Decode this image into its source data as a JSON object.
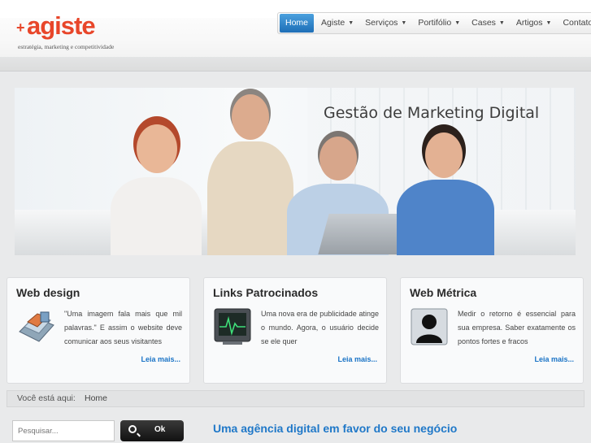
{
  "brand": {
    "plus": "+",
    "name": "agiste",
    "tagline": "estratégia, marketing e competitividade"
  },
  "nav": {
    "items": [
      {
        "label": "Home",
        "active": true,
        "caret": false
      },
      {
        "label": "Agiste",
        "active": false,
        "caret": true
      },
      {
        "label": "Serviços",
        "active": false,
        "caret": true
      },
      {
        "label": "Portifólio",
        "active": false,
        "caret": true
      },
      {
        "label": "Cases",
        "active": false,
        "caret": true
      },
      {
        "label": "Artigos",
        "active": false,
        "caret": true
      },
      {
        "label": "Contato",
        "active": false,
        "caret": true
      }
    ]
  },
  "banner": {
    "title": "Gestão de Marketing Digital"
  },
  "features": [
    {
      "title": "Web design",
      "icon": "web-design-icon",
      "text": "\"Uma imagem fala mais que mil palavras.\" E assim o website deve comunicar aos seus visitantes",
      "more": "Leia mais..."
    },
    {
      "title": "Links Patrocinados",
      "icon": "monitor-pulse-icon",
      "text": "Uma nova era de publicidade atinge o mundo. Agora, o usuário decide se ele quer",
      "more": "Leia mais..."
    },
    {
      "title": "Web Métrica",
      "icon": "user-silhouette-icon",
      "text": "Medir o retorno é essencial para sua empresa. Saber exatamente os pontos fortes e fracos",
      "more": "Leia mais..."
    }
  ],
  "breadcrumb": {
    "label": "Você está aqui:",
    "current": "Home"
  },
  "search": {
    "placeholder": "Pesquisar...",
    "button": "Ok"
  },
  "main": {
    "title": "Uma agência digital em favor do seu negócio"
  },
  "colors": {
    "brand": "#e8462a",
    "accent": "#1f78c8",
    "nav_active": "#2b82c9"
  }
}
